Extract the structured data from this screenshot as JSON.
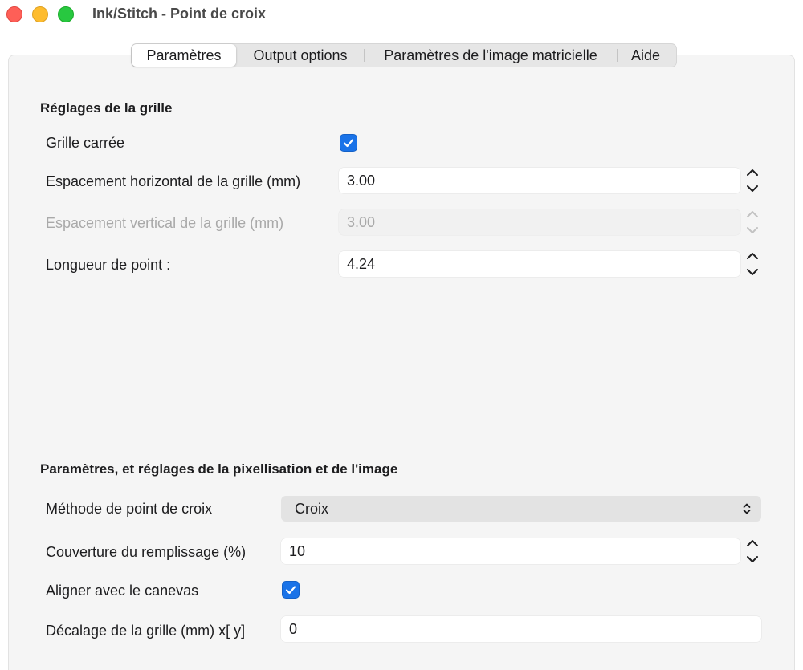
{
  "window": {
    "title": "Ink/Stitch - Point de croix"
  },
  "tabs": [
    {
      "label": "Paramètres",
      "active": true
    },
    {
      "label": "Output options",
      "active": false
    },
    {
      "label": "Paramètres de l'image matricielle",
      "active": false
    },
    {
      "label": "Aide",
      "active": false
    }
  ],
  "grid_section": {
    "title": "Réglages de la grille",
    "square_grid": {
      "label": "Grille carrée",
      "checked": true
    },
    "h_spacing": {
      "label": "Espacement horizontal de la grille (mm)",
      "value": "3.00"
    },
    "v_spacing": {
      "label": "Espacement vertical de la grille (mm)",
      "value": "3.00",
      "disabled": true
    },
    "stitch_length": {
      "label": "Longueur de point :",
      "value": "4.24"
    }
  },
  "pixel_section": {
    "title": "Paramètres, et réglages de la pixellisation et de l'image",
    "method": {
      "label": "Méthode de point de croix",
      "value": "Croix"
    },
    "coverage": {
      "label": "Couverture du remplissage (%)",
      "value": "10"
    },
    "align_canvas": {
      "label": "Aligner avec le canevas",
      "checked": true
    },
    "grid_offset": {
      "label": "Décalage de la grille (mm) x[ y]",
      "value": "0"
    }
  },
  "colors": {
    "accent": "#1a73e8",
    "close": "#fe5f57",
    "minimize": "#febc2e",
    "maximize": "#28c840"
  }
}
